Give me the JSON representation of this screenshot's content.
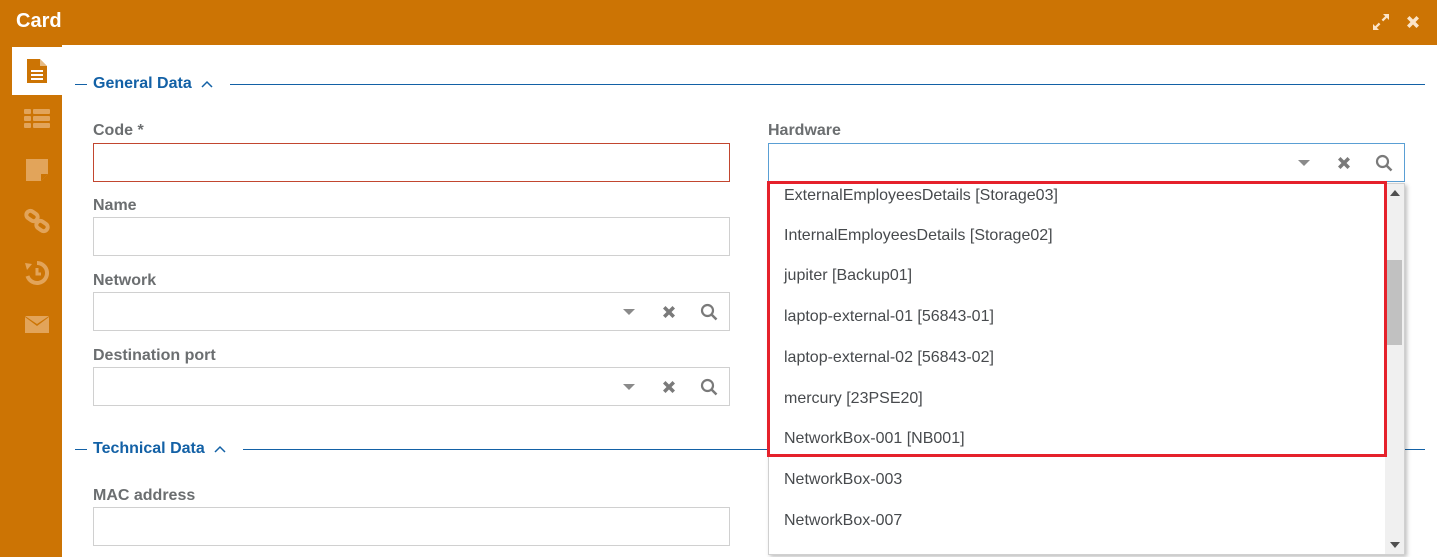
{
  "window": {
    "title": "Card",
    "maximize_icon": "expand-arrows-icon",
    "close_icon": "close-x-icon"
  },
  "sidebar": {
    "items": [
      {
        "name": "card-details",
        "icon": "document-icon",
        "active": true
      },
      {
        "name": "detail-list",
        "icon": "list-icon",
        "active": false
      },
      {
        "name": "notes",
        "icon": "sticky-note-icon",
        "active": false
      },
      {
        "name": "relations",
        "icon": "link-icon",
        "active": false
      },
      {
        "name": "history",
        "icon": "history-icon",
        "active": false
      },
      {
        "name": "emails",
        "icon": "envelope-icon",
        "active": false
      }
    ]
  },
  "sections": {
    "general": {
      "title": "General Data",
      "toggle_icon": "chevron-up-icon"
    },
    "technical": {
      "title": "Technical Data",
      "toggle_icon": "chevron-up-icon"
    }
  },
  "fields": {
    "code": {
      "label": "Code *",
      "value": ""
    },
    "name": {
      "label": "Name",
      "value": ""
    },
    "network": {
      "label": "Network",
      "value": ""
    },
    "destination_port": {
      "label": "Destination port",
      "value": ""
    },
    "hardware": {
      "label": "Hardware",
      "value": ""
    },
    "mac_address": {
      "label": "MAC address",
      "value": ""
    }
  },
  "hardware_dropdown": {
    "options": [
      "ExternalEmployeesDetails [Storage03]",
      "InternalEmployeesDetails [Storage02]",
      "jupiter [Backup01]",
      "laptop-external-01 [56843-01]",
      "laptop-external-02 [56843-02]",
      "mercury [23PSE20]",
      "NetworkBox-001 [NB001]",
      "NetworkBox-003",
      "NetworkBox-007"
    ]
  },
  "colors": {
    "brand": "#cc7404",
    "section_title": "#1361a6",
    "error_border": "#c2462f",
    "highlight": "#e5212b"
  }
}
